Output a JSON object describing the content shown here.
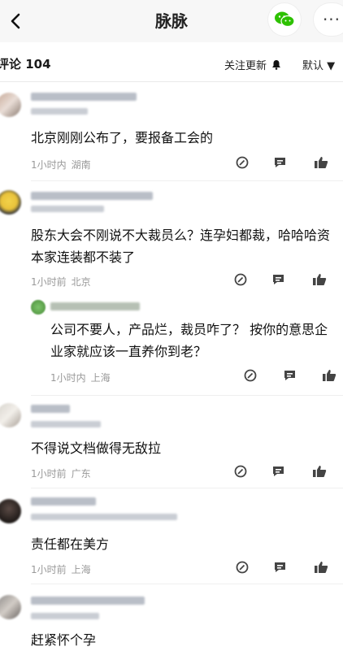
{
  "header": {
    "back_icon": "chevron-left-icon",
    "title": "脉脉",
    "share_icon": "wechat-icon",
    "more_label": "···"
  },
  "toolbar": {
    "comments_label": "评论",
    "comments_count": "104",
    "follow_label": "关注更新",
    "sort_label": "默认"
  },
  "comments": [
    {
      "text": "北京刚刚公布了，要报备工会的",
      "time": "1小时内",
      "location": "湖南"
    },
    {
      "text": "股东大会不刚说不大裁员么？连孕妇都裁，哈哈哈资本家连装都不装了",
      "time": "1小时前",
      "location": "北京",
      "reply": {
        "text": "公司不要人，产品烂，裁员咋了？ 按你的意思企业家就应该一直养你到老？",
        "time": "1小时内",
        "location": "上海"
      }
    },
    {
      "text": "不得说文档做得无敌拉",
      "time": "1小时前",
      "location": "广东"
    },
    {
      "text": "责任都在美方",
      "time": "1小时前",
      "location": "上海"
    },
    {
      "text": "赶紧怀个孕"
    }
  ]
}
